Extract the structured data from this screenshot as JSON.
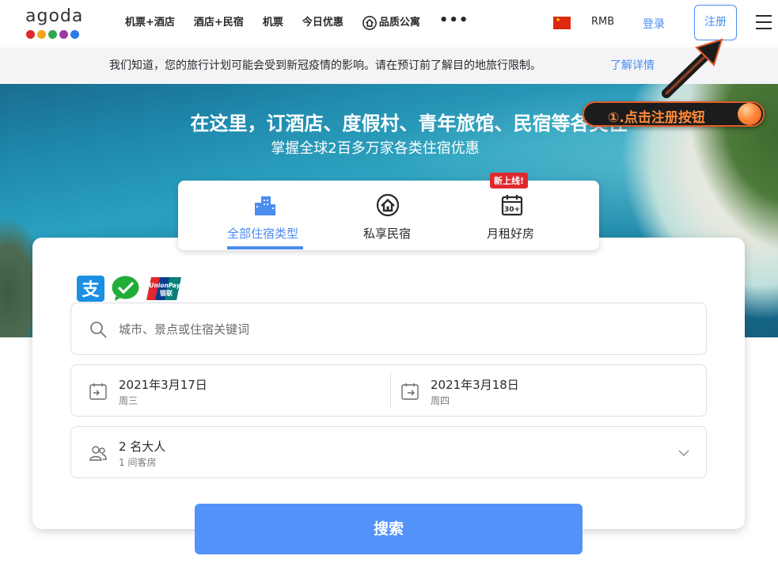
{
  "header": {
    "logo_text": "agoda",
    "logo_dot_colors": [
      "#e0282e",
      "#f3a51c",
      "#2ea84d",
      "#9b3aa6",
      "#2c7be5"
    ],
    "nav": [
      {
        "label": "机票+酒店"
      },
      {
        "label": "酒店+民宿"
      },
      {
        "label": "机票"
      },
      {
        "label": "今日优惠"
      },
      {
        "label": "品质公寓",
        "icon": "house-icon"
      }
    ],
    "more_icon": "more-dots-icon",
    "currency": "RMB",
    "login": "登录",
    "register": "注册",
    "menu_icon": "hamburger-menu-icon"
  },
  "notice": {
    "text": "我们知道，您的旅行计划可能会受到新冠疫情的影响。请在预订前了解目的地旅行限制。",
    "link": "了解详情"
  },
  "hero": {
    "title": "在这里，订酒店、度假村、青年旅馆、民宿等各类住",
    "subtitle": "掌握全球2百多万家各类住宿优惠"
  },
  "annotation": {
    "text": "①.点击注册按钮"
  },
  "tabs": [
    {
      "label": "全部住宿类型",
      "icon": "hotel-building-icon",
      "active": true
    },
    {
      "label": "私享民宿",
      "icon": "home-icon",
      "active": false
    },
    {
      "label": "月租好房",
      "icon": "calendar-30-icon",
      "active": false,
      "badge": "新上线!"
    }
  ],
  "payment_icons": [
    "alipay-icon",
    "wechat-pay-icon",
    "unionpay-icon"
  ],
  "unionpay_text": "UnionPay",
  "unionpay_cn": "银联",
  "search": {
    "placeholder": "城市、景点或住宿关键词"
  },
  "checkin": {
    "date": "2021年3月17日",
    "weekday": "周三"
  },
  "checkout": {
    "date": "2021年3月18日",
    "weekday": "周四"
  },
  "guests": {
    "main": "2 名大人",
    "sub": "1 间客房"
  },
  "search_button": "搜索",
  "colors": {
    "accent": "#4a8cf0",
    "search_button": "#5392f9",
    "badge": "#e0282e",
    "annotation_text": "#ff8a3a"
  }
}
